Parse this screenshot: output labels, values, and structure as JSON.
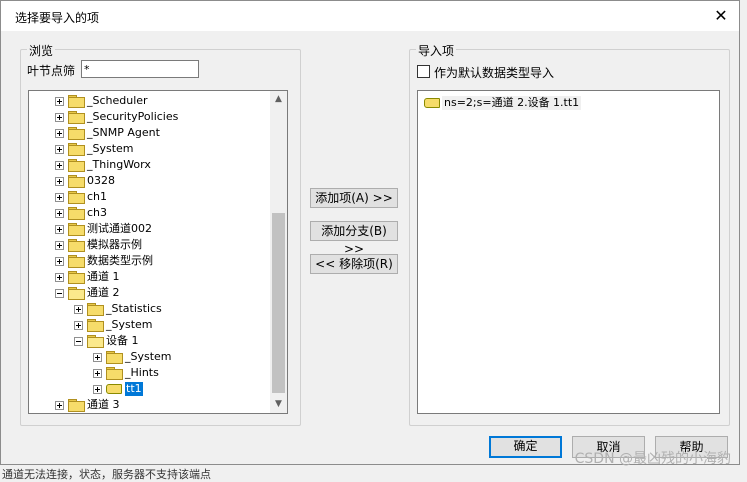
{
  "dialog": {
    "title": "选择要导入的项",
    "close_glyph": "✕"
  },
  "browse": {
    "group_label": "浏览",
    "filter_label": "叶节点筛",
    "filter_value": "*"
  },
  "tree": {
    "items": [
      {
        "label": "_Scheduler",
        "level": 0,
        "icon": "folder-icon",
        "expanded": false
      },
      {
        "label": "_SecurityPolicies",
        "level": 0,
        "icon": "folder-icon",
        "expanded": false
      },
      {
        "label": "_SNMP Agent",
        "level": 0,
        "icon": "folder-icon",
        "expanded": false
      },
      {
        "label": "_System",
        "level": 0,
        "icon": "folder-icon",
        "expanded": false
      },
      {
        "label": "_ThingWorx",
        "level": 0,
        "icon": "folder-icon",
        "expanded": false
      },
      {
        "label": "0328",
        "level": 0,
        "icon": "folder-icon",
        "expanded": false
      },
      {
        "label": "ch1",
        "level": 0,
        "icon": "folder-icon",
        "expanded": false
      },
      {
        "label": "ch3",
        "level": 0,
        "icon": "folder-icon",
        "expanded": false
      },
      {
        "label": "测试通道002",
        "level": 0,
        "icon": "folder-icon",
        "expanded": false
      },
      {
        "label": "模拟器示例",
        "level": 0,
        "icon": "folder-icon",
        "expanded": false
      },
      {
        "label": "数据类型示例",
        "level": 0,
        "icon": "folder-icon",
        "expanded": false
      },
      {
        "label": "通道 1",
        "level": 0,
        "icon": "folder-icon",
        "expanded": false
      },
      {
        "label": "通道 2",
        "level": 0,
        "icon": "folder-open-icon",
        "expanded": true
      },
      {
        "label": "_Statistics",
        "level": 1,
        "icon": "folder-icon",
        "expanded": false
      },
      {
        "label": "_System",
        "level": 1,
        "icon": "folder-icon",
        "expanded": false
      },
      {
        "label": "设备 1",
        "level": 1,
        "icon": "folder-open-icon",
        "expanded": true
      },
      {
        "label": "_System",
        "level": 2,
        "icon": "folder-icon",
        "expanded": false
      },
      {
        "label": "_Hints",
        "level": 2,
        "icon": "folder-icon",
        "expanded": false
      },
      {
        "label": "tt1",
        "level": 2,
        "icon": "tag-icon",
        "expanded": false,
        "selected": true
      },
      {
        "label": "通道 3",
        "level": 0,
        "icon": "folder-icon",
        "expanded": false
      }
    ]
  },
  "actions": {
    "add_item": "添加项(A) >>",
    "add_branch": "添加分支(B) >>",
    "remove_item": "<< 移除项(R)"
  },
  "import": {
    "group_label": "导入项",
    "default_type_label": "作为默认数据类型导入",
    "default_type_checked": false,
    "items": [
      "ns=2;s=通道 2.设备 1.tt1"
    ]
  },
  "footer": {
    "ok": "确定",
    "cancel": "取消",
    "help": "帮助"
  },
  "outside": {
    "status_text": "通道无法连接，状态，服务器不支持该端点",
    "watermark": "CSDN @最凶残的小海豹"
  },
  "colors": {
    "selection": "#0078d7",
    "folder": "#f6dc6a"
  }
}
